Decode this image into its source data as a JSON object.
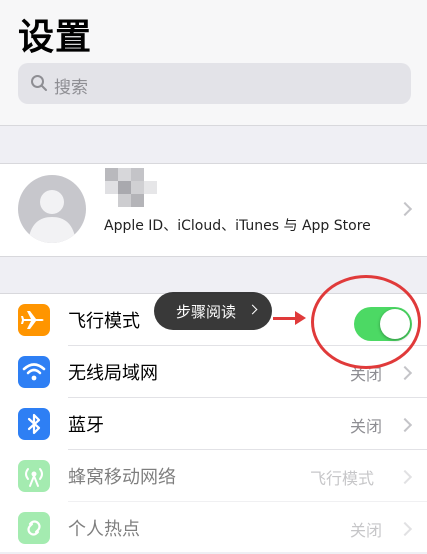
{
  "header": {
    "title": "设置",
    "search_placeholder": "搜索"
  },
  "account": {
    "subtitle": "Apple ID、iCloud、iTunes 与 App Store"
  },
  "rows": [
    {
      "label": "飞行模式",
      "value": "",
      "toggle": "on"
    },
    {
      "label": "无线局域网",
      "value": "关闭"
    },
    {
      "label": "蓝牙",
      "value": "关闭"
    },
    {
      "label": "蜂窝移动网络",
      "value": "飞行模式"
    },
    {
      "label": "个人热点",
      "value": "关闭"
    }
  ],
  "overlay": {
    "tooltip_text": "步骤阅读"
  },
  "colors": {
    "airplane": "#ff9500",
    "wifi": "#2e7ff4",
    "bluetooth": "#2e7ff4",
    "cellular": "#4cd964",
    "hotspot": "#4cd964",
    "toggle_on": "#4cd964",
    "annotation": "#e03a3a"
  },
  "icons": [
    "search-icon",
    "avatar-icon",
    "airplane-icon",
    "wifi-icon",
    "bluetooth-icon",
    "cellular-icon",
    "hotspot-icon",
    "chevron-right-icon"
  ]
}
